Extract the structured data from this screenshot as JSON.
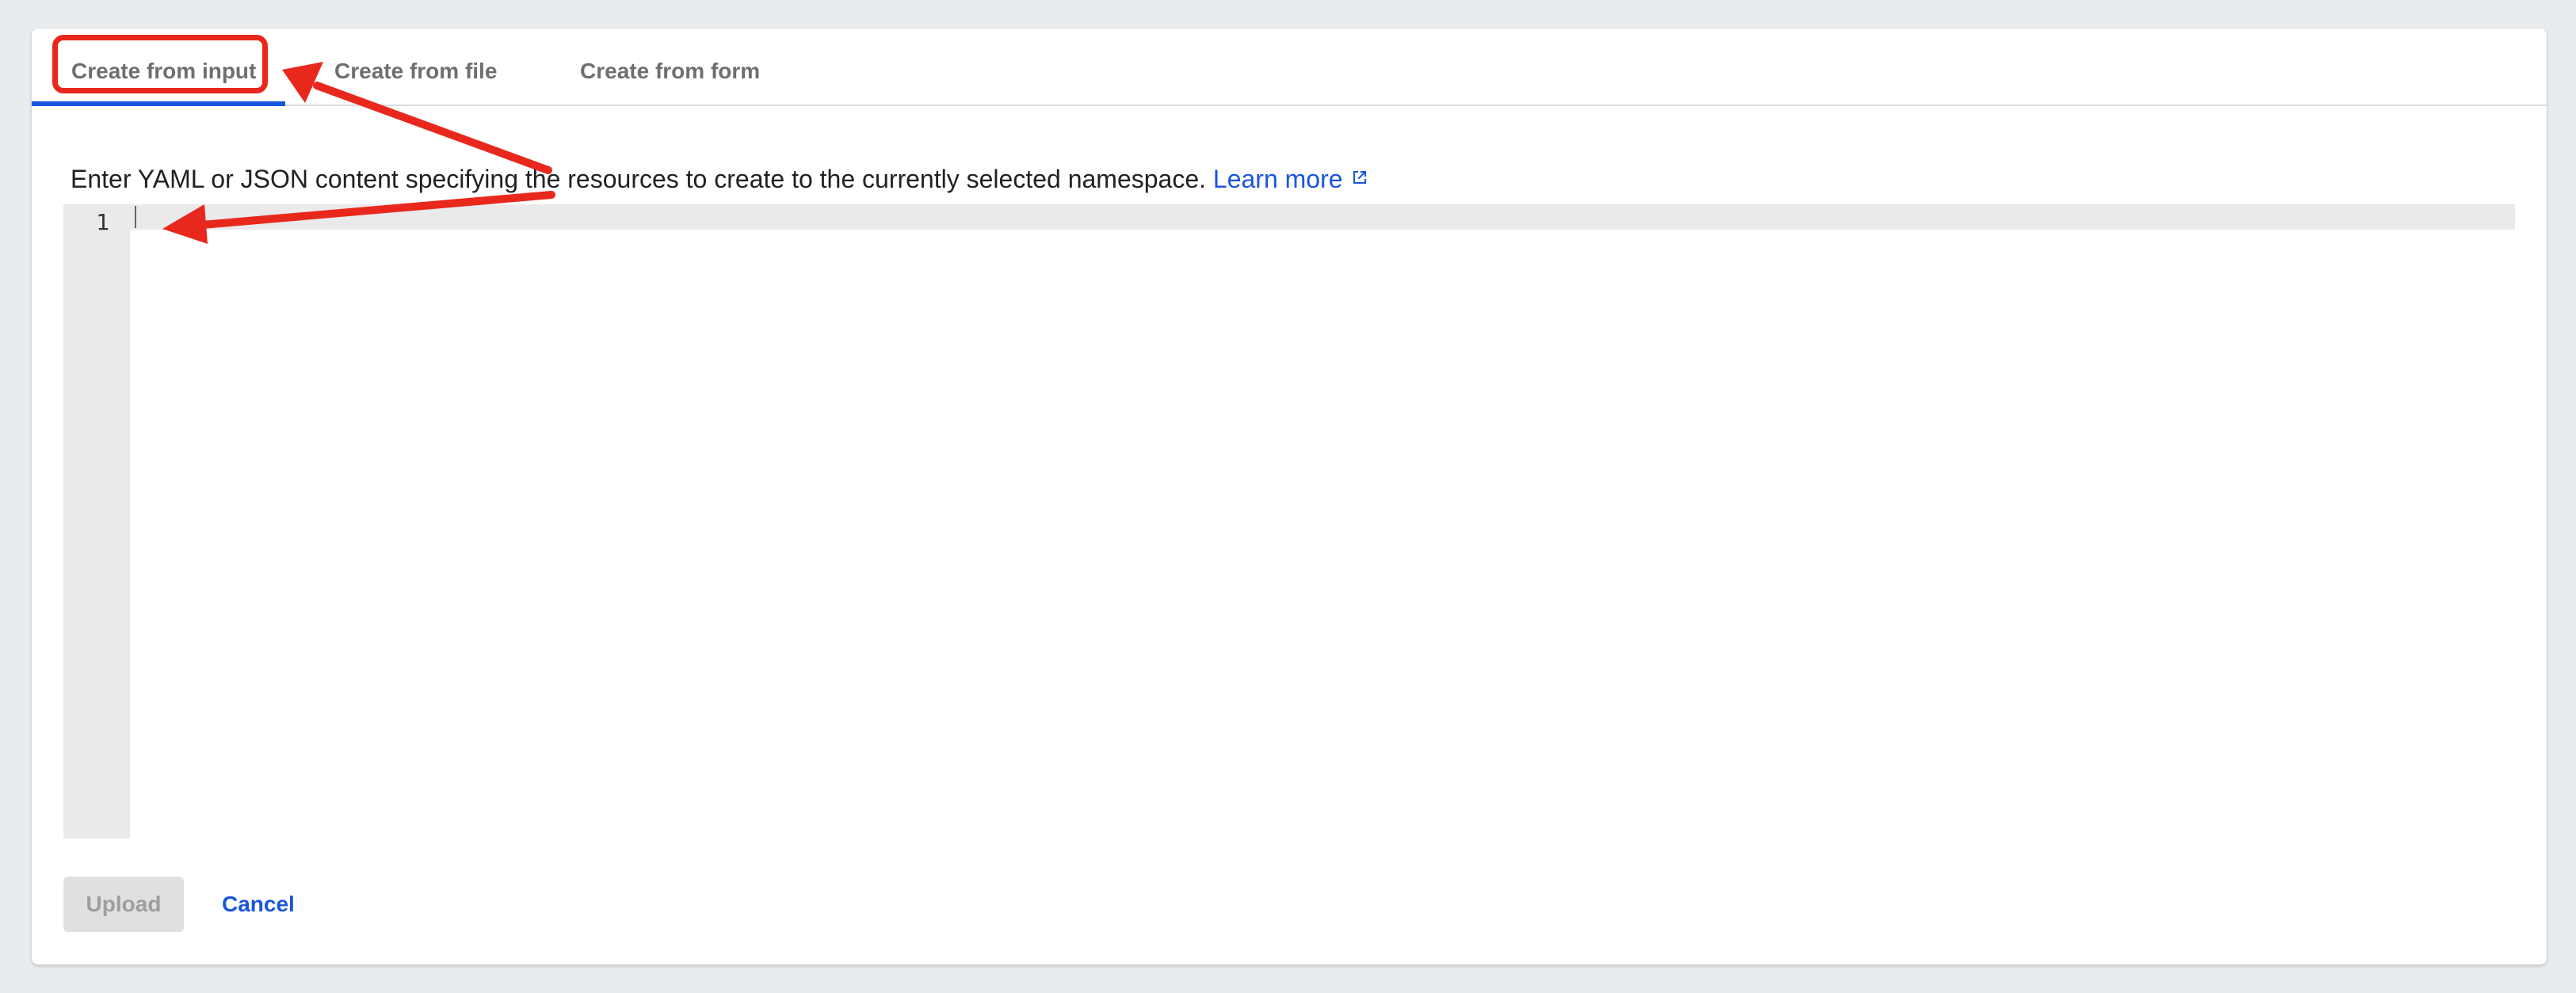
{
  "tabs": [
    {
      "label": "Create from input",
      "active": true
    },
    {
      "label": "Create from file",
      "active": false
    },
    {
      "label": "Create from form",
      "active": false
    }
  ],
  "description": {
    "text": "Enter YAML or JSON content specifying the resources to create to the currently selected namespace.",
    "link_label": "Learn more",
    "link_icon": "external-link-icon"
  },
  "editor": {
    "line_numbers": [
      "1"
    ],
    "content": ""
  },
  "actions": {
    "upload_label": "Upload",
    "upload_disabled": true,
    "cancel_label": "Cancel"
  },
  "colors": {
    "accent": "#1a56db",
    "annotation": "#e8281d",
    "background": "#e9ecee"
  }
}
